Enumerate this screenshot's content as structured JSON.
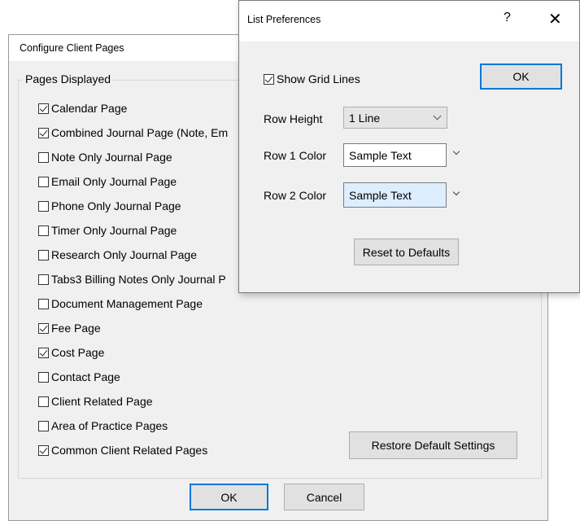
{
  "configure_window": {
    "title": "Configure Client Pages",
    "group_label": "Pages Displayed",
    "pages": [
      {
        "label": "Calendar Page",
        "checked": true
      },
      {
        "label": "Combined Journal Page (Note, Em",
        "checked": true
      },
      {
        "label": "Note Only Journal Page",
        "checked": false
      },
      {
        "label": "Email Only Journal Page",
        "checked": false
      },
      {
        "label": "Phone Only Journal Page",
        "checked": false
      },
      {
        "label": "Timer Only Journal Page",
        "checked": false
      },
      {
        "label": "Research Only Journal Page",
        "checked": false
      },
      {
        "label": "Tabs3 Billing Notes Only Journal P",
        "checked": false
      },
      {
        "label": "Document Management Page",
        "checked": false
      },
      {
        "label": "Fee Page",
        "checked": true
      },
      {
        "label": "Cost Page",
        "checked": true
      },
      {
        "label": "Contact Page",
        "checked": false
      },
      {
        "label": "Client Related Page",
        "checked": false
      },
      {
        "label": "Area of Practice Pages",
        "checked": false
      },
      {
        "label": "Common Client Related Pages",
        "checked": true
      }
    ],
    "restore_button": "Restore Default Settings",
    "ok_button": "OK",
    "cancel_button": "Cancel"
  },
  "list_preferences": {
    "title": "List Preferences",
    "help_glyph": "?",
    "close_glyph": "✕",
    "show_grid_lines_label": "Show Grid Lines",
    "show_grid_lines_checked": true,
    "ok_button": "OK",
    "row_height_label": "Row Height",
    "row_height_value": "1 Line",
    "row1_color_label": "Row 1 Color",
    "row1_color_sample": "Sample Text",
    "row1_color_bg": "#ffffff",
    "row2_color_label": "Row 2 Color",
    "row2_color_sample": "Sample Text",
    "row2_color_bg": "#ddeeff",
    "reset_button": "Reset to Defaults"
  },
  "colors": {
    "accent": "#0078d7",
    "dialog_bg": "#f0f0f0",
    "button_bg": "#e1e1e1"
  }
}
